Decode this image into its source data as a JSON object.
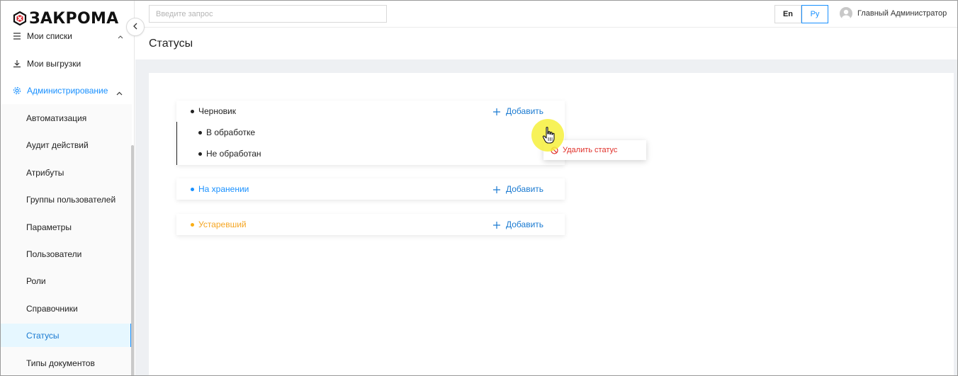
{
  "app": {
    "logo_text": "ЗАКРОМА"
  },
  "sidebar": {
    "items": [
      {
        "label": "Мои списки",
        "icon": "list-icon"
      },
      {
        "label": "Мои выгрузки",
        "icon": "download-icon"
      },
      {
        "label": "Администрирование",
        "icon": "gear-icon",
        "expanded": true
      }
    ],
    "admin_items": [
      {
        "label": "Автоматизация"
      },
      {
        "label": "Аудит действий"
      },
      {
        "label": "Атрибуты"
      },
      {
        "label": "Группы пользователей"
      },
      {
        "label": "Параметры"
      },
      {
        "label": "Пользователи"
      },
      {
        "label": "Роли"
      },
      {
        "label": "Справочники"
      },
      {
        "label": "Статусы",
        "active": true
      },
      {
        "label": "Типы документов"
      }
    ]
  },
  "header": {
    "search_placeholder": "Введите запрос",
    "lang_en": "En",
    "lang_ru": "Ру",
    "selected_lang": "Ру",
    "user_name": "Главный Администратор"
  },
  "page": {
    "title": "Статусы"
  },
  "statuses": [
    {
      "label": "Черновик",
      "color": "#222222",
      "add_label": "Добавить",
      "children": [
        {
          "label": "В обработке"
        },
        {
          "label": "Не обработан"
        }
      ]
    },
    {
      "label": "На хранении",
      "color": "#1890ff",
      "add_label": "Добавить",
      "children": []
    },
    {
      "label": "Устаревший",
      "color": "#faad14",
      "add_label": "Добавить",
      "children": []
    }
  ],
  "context_menu": {
    "delete_label": "Удалить статус",
    "color": "#e0302a"
  },
  "colors": {
    "accent": "#1890ff",
    "active_bg": "#e6f7ff",
    "danger": "#e0302a"
  }
}
